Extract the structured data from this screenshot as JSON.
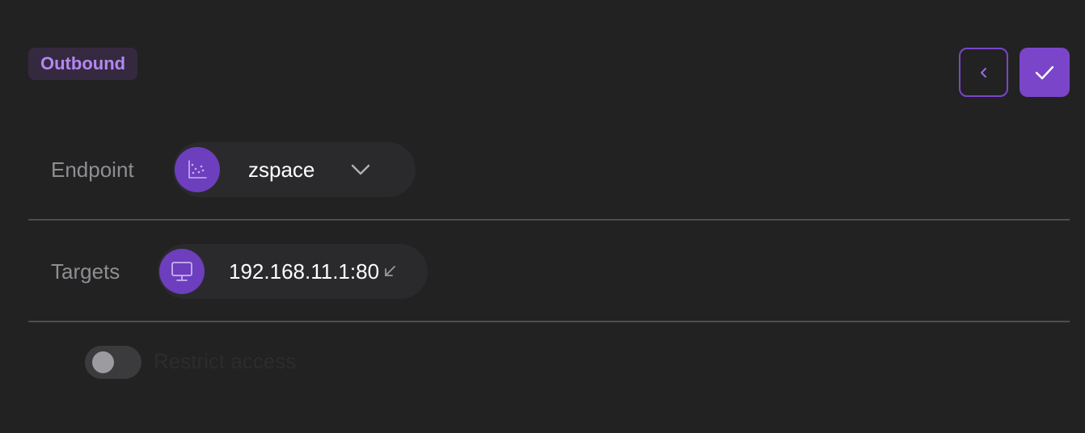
{
  "header": {
    "badge_label": "Outbound"
  },
  "actions": {
    "back_icon": "chevron-left-icon",
    "confirm_icon": "check-icon"
  },
  "endpoint": {
    "label": "Endpoint",
    "value": "zspace",
    "icon": "scatter-chart-icon"
  },
  "targets": {
    "label": "Targets",
    "value": "192.168.11.1:80",
    "icon": "monitor-icon",
    "action_icon": "arrow-down-left-icon"
  },
  "access": {
    "label": "Restrict access",
    "enabled": false
  },
  "colors": {
    "accent": "#7b45c9",
    "background": "#222222"
  }
}
